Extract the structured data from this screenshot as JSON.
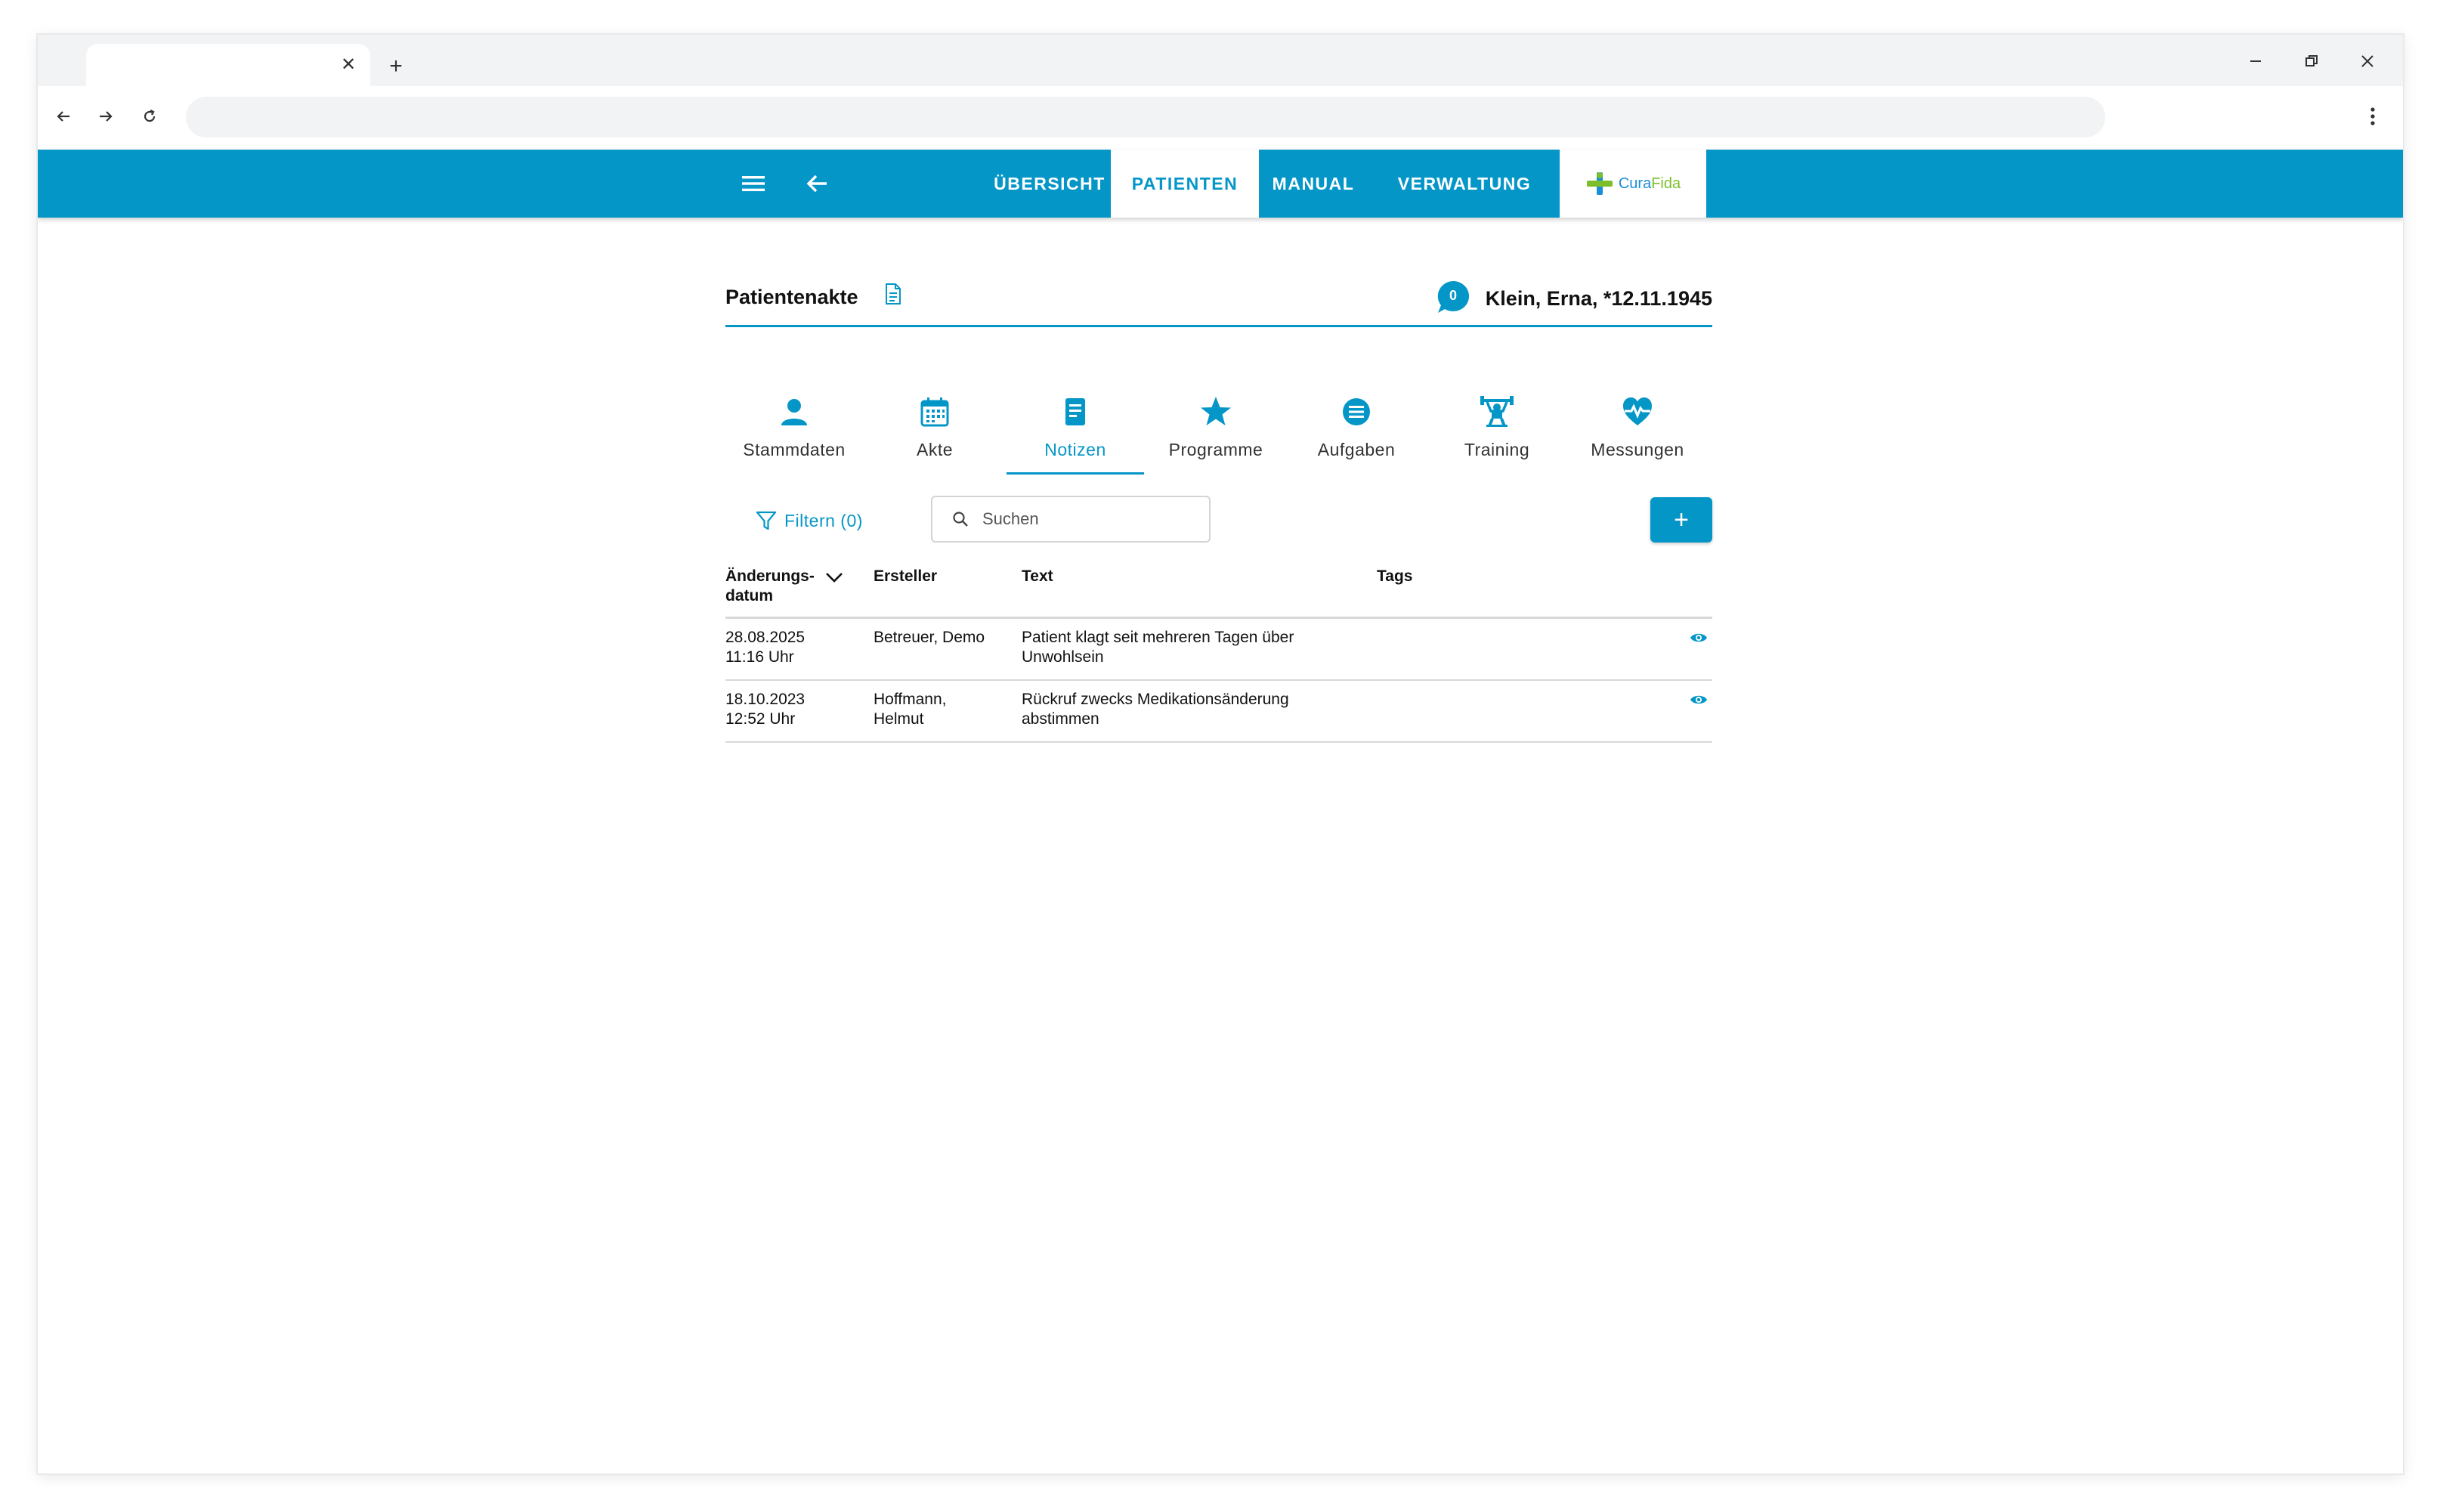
{
  "app": {
    "nav": {
      "items": [
        {
          "label": "ÜBERSICHT",
          "active": false
        },
        {
          "label": "PATIENTEN",
          "active": true
        },
        {
          "label": "MANUAL",
          "active": false
        },
        {
          "label": "VERWALTUNG",
          "active": false
        }
      ],
      "logo": {
        "part1": "Cura",
        "part2": "Fida"
      }
    },
    "colors": {
      "accent": "#0596c8",
      "logo_blue": "#1a8fd6",
      "logo_green": "#7dbf2a"
    }
  },
  "record": {
    "title": "Patientenakte",
    "message_count": "0",
    "patient": "Klein, Erna, *12.11.1945"
  },
  "subtabs": [
    {
      "label": "Stammdaten",
      "icon": "person-icon",
      "active": false
    },
    {
      "label": "Akte",
      "icon": "calendar-icon",
      "active": false
    },
    {
      "label": "Notizen",
      "icon": "note-icon",
      "active": true
    },
    {
      "label": "Programme",
      "icon": "star-icon",
      "active": false
    },
    {
      "label": "Aufgaben",
      "icon": "list-icon",
      "active": false
    },
    {
      "label": "Training",
      "icon": "training-icon",
      "active": false
    },
    {
      "label": "Messungen",
      "icon": "heart-pulse-icon",
      "active": false
    }
  ],
  "toolbar": {
    "filter_label": "Filtern (0)",
    "search_placeholder": "Suchen",
    "add_label": "+"
  },
  "table": {
    "headers": {
      "date_line1": "Änderungs-",
      "date_line2": "datum",
      "author": "Ersteller",
      "text": "Text",
      "tags": "Tags"
    },
    "rows": [
      {
        "date": "28.08.2025",
        "time": "11:16 Uhr",
        "author_line1": "Betreuer, Demo",
        "author_line2": "",
        "text_line1": "Patient klagt seit mehreren Tagen über",
        "text_line2": "Unwohlsein",
        "tags": ""
      },
      {
        "date": "18.10.2023",
        "time": "12:52 Uhr",
        "author_line1": "Hoffmann,",
        "author_line2": "Helmut",
        "text_line1": "Rückruf zwecks Medikationsänderung",
        "text_line2": "abstimmen",
        "tags": ""
      }
    ]
  }
}
